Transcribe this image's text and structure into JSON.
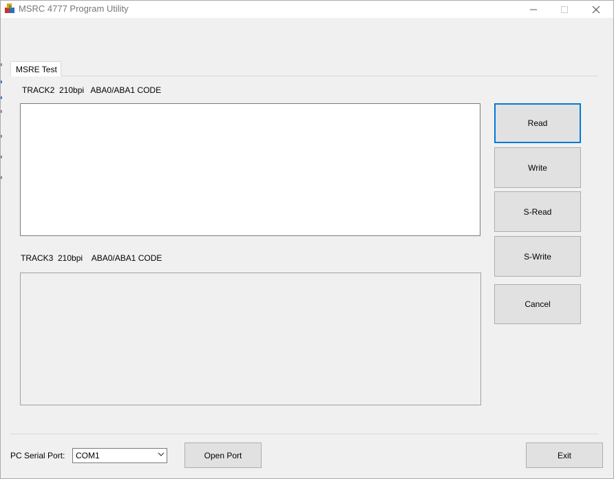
{
  "window": {
    "title": "MSRC 4777 Program Utility"
  },
  "tabs": [
    {
      "label": "MSRE Test",
      "selected": true
    }
  ],
  "track2": {
    "label": "TRACK2  210bpi   ABA0/ABA1 CODE",
    "value": ""
  },
  "track3": {
    "label": "TRACK3  210bpi    ABA0/ABA1 CODE",
    "value": ""
  },
  "actions": {
    "read": "Read",
    "write": "Write",
    "s_read": "S-Read",
    "s_write": "S-Write",
    "cancel": "Cancel"
  },
  "footer": {
    "serial_port_label": "PC Serial Port:",
    "serial_port_value": "COM1",
    "open_port": "Open Port",
    "exit": "Exit"
  },
  "colors": {
    "accent": "#0078d7",
    "window_bg": "#f0f0f0",
    "button_bg": "#e1e1e1"
  }
}
